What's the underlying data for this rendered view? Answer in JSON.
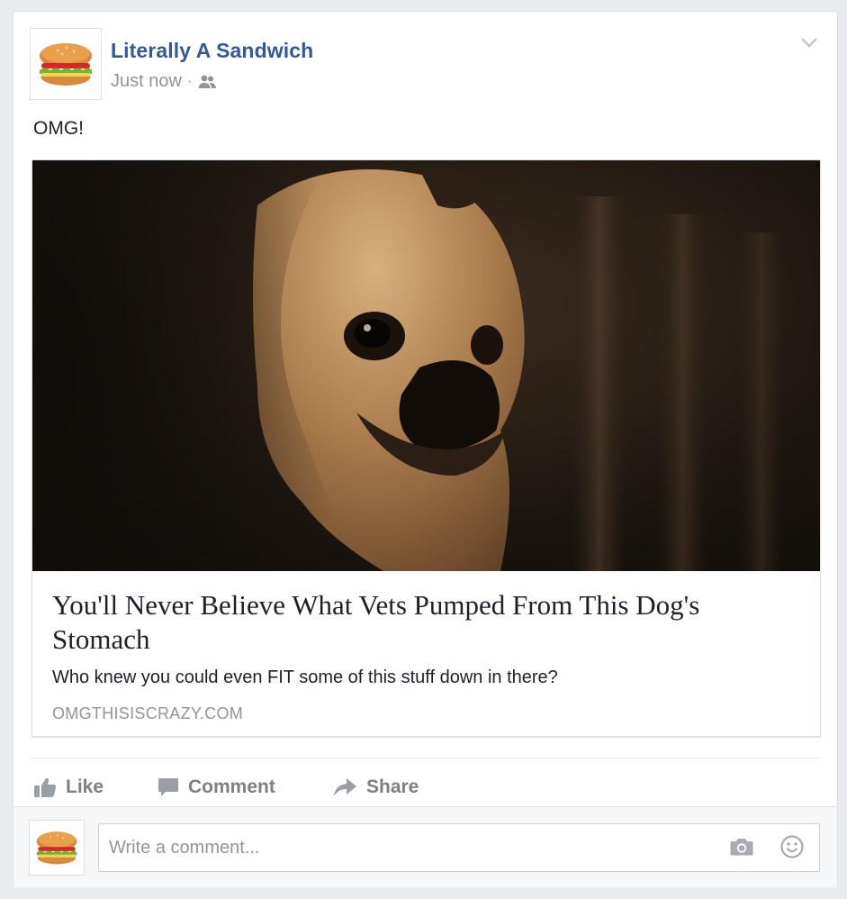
{
  "post": {
    "author": "Literally A Sandwich",
    "timestamp": "Just now",
    "separator": "·",
    "audience_icon": "friends-icon",
    "menu_icon": "chevron-down-icon",
    "status_text": "OMG!"
  },
  "link_preview": {
    "image_icon": "pug-photo",
    "title": "You'll Never Believe What Vets Pumped From This Dog's Stomach",
    "description": "Who knew you could even FIT some of this stuff down in there?",
    "domain": "OMGTHISISCRAZY.COM"
  },
  "actions": {
    "like_label": "Like",
    "comment_label": "Comment",
    "share_label": "Share"
  },
  "comment_box": {
    "placeholder": "Write a comment...",
    "camera_icon": "camera-icon",
    "emoji_icon": "smiley-icon"
  },
  "colors": {
    "author_blue": "#365899",
    "muted_gray": "#90949c",
    "action_gray": "#7f7f7f",
    "page_bg": "#e9ebee"
  }
}
